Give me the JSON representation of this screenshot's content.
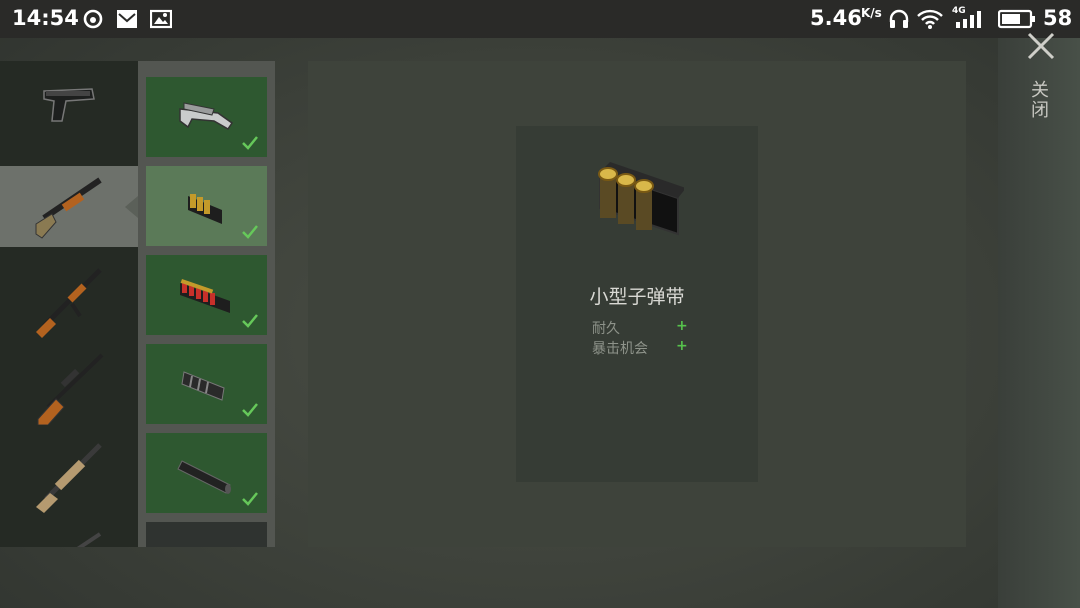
{
  "status_bar": {
    "time": "14:54",
    "net_speed": "5.46",
    "net_unit": "K/s",
    "network_type": "4G",
    "battery": "58",
    "icons": [
      "weibo-icon",
      "mail-icon",
      "image-icon",
      "headphones-icon",
      "wifi-icon",
      "signal-icon",
      "battery-icon"
    ]
  },
  "weapons": [
    {
      "name": "pistol",
      "selected": false
    },
    {
      "name": "shotgun",
      "selected": true
    },
    {
      "name": "ak-rifle",
      "selected": false
    },
    {
      "name": "sniper-rifle",
      "selected": false
    },
    {
      "name": "scar-rifle",
      "selected": false
    },
    {
      "name": "rifle-partial",
      "selected": false
    }
  ],
  "attachments": [
    {
      "name": "stock-attachment",
      "equipped": true,
      "selected": false
    },
    {
      "name": "small-shell-holder",
      "equipped": true,
      "selected": true
    },
    {
      "name": "shell-belt",
      "equipped": true,
      "selected": false
    },
    {
      "name": "muzzle-brake",
      "equipped": true,
      "selected": false
    },
    {
      "name": "suppressor",
      "equipped": true,
      "selected": false
    },
    {
      "name": "locked-attachment",
      "equipped": false,
      "selected": false
    }
  ],
  "detail": {
    "item_name": "小型子弹带",
    "stats": [
      {
        "label": "耐久",
        "sign": "+"
      },
      {
        "label": "暴击机会",
        "sign": "+"
      }
    ]
  },
  "close": {
    "label": "关闭"
  },
  "colors": {
    "equipped_green": "#2e5830",
    "selected_green": "#5b7a58",
    "plus_green": "#56c24c"
  }
}
